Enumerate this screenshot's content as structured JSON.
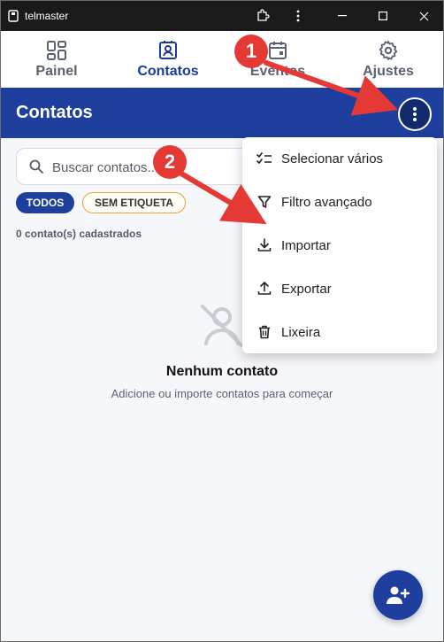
{
  "window": {
    "title": "telmaster"
  },
  "nav": {
    "items": [
      {
        "label": "Painel",
        "icon": "dashboard-icon",
        "active": false
      },
      {
        "label": "Contatos",
        "icon": "contacts-icon",
        "active": true
      },
      {
        "label": "Eventos",
        "icon": "calendar-icon",
        "active": false
      },
      {
        "label": "Ajustes",
        "icon": "gear-icon",
        "active": false
      }
    ]
  },
  "header": {
    "title": "Contatos"
  },
  "search": {
    "placeholder": "Buscar contatos..."
  },
  "filters": {
    "all": "TODOS",
    "untagged": "SEM ETIQUETA"
  },
  "count_text": "0 contato(s) cadastrados",
  "empty": {
    "title": "Nenhum contato",
    "subtitle": "Adicione ou importe contatos para começar"
  },
  "menu": {
    "items": [
      {
        "label": "Selecionar vários",
        "icon": "checklist-icon"
      },
      {
        "label": "Filtro avançado",
        "icon": "filter-icon"
      },
      {
        "label": "Importar",
        "icon": "download-icon"
      },
      {
        "label": "Exportar",
        "icon": "upload-icon"
      },
      {
        "label": "Lixeira",
        "icon": "trash-icon"
      }
    ]
  },
  "annotations": {
    "step1": "1",
    "step2": "2"
  },
  "colors": {
    "primary": "#1e3f9e",
    "accent_red": "#e53935",
    "chip_border": "#e0a83a"
  }
}
